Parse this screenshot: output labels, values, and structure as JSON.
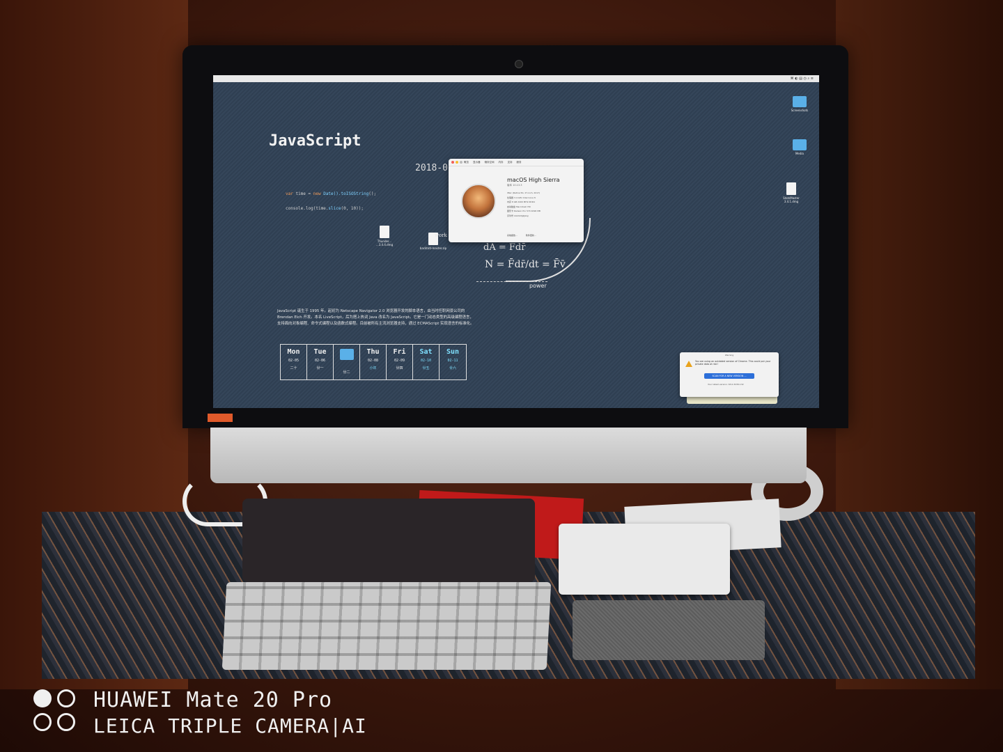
{
  "screen": {
    "title": "JavaScript",
    "date_fragment": "2018-0",
    "code_lines": [
      {
        "kw": "var",
        "rest": " time = ",
        "kw2": "new",
        "fn": " Date().toISOString",
        "tail": "();"
      },
      {
        "plain": "console.log(time.",
        "fn": "slice",
        "tail": "(0, 10));"
      }
    ],
    "desktop_icons": [
      {
        "label": "Thunder...\n...3.4.4.dmg",
        "kind": "doc"
      },
      {
        "label": "backtotl-master.zip",
        "kind": "doc"
      },
      {
        "label": "Screenshots",
        "kind": "folder"
      },
      {
        "label": "Media",
        "kind": "folder"
      },
      {
        "label": "StatsMaster 3.4.1.dmg",
        "kind": "doc"
      }
    ],
    "formulas": {
      "dA": "dA = F̄dr̄",
      "N": "N = F̄dr̄/dt = F̄v̄",
      "caption": "power",
      "side_word": "work"
    },
    "paragraph": "JavaScript 诞生于 1995 年。起初为 Netscape Navigator 2.0 浏览器开发的脚本语言，由当时任职网景公司的 Brendan Eich 开发。本名 LiveScript，后为搭上热词 Java 改名为 JavaScript。它是一门动态类型的高级编程语言，支持面向对象编程、命令式编程以及函数式编程。目前被所有主流浏览器支持，通过 ECMAScript 实现语言的标准化。",
    "calendar": [
      {
        "day": "Mon",
        "date": "02-05",
        "lunar": "二十",
        "weekend": false
      },
      {
        "day": "Tue",
        "date": "02-06",
        "lunar": "廿一",
        "weekend": false
      },
      {
        "day": "",
        "date": "",
        "lunar": "廿二",
        "weekend": false,
        "folder": true
      },
      {
        "day": "Thu",
        "date": "02-08",
        "lunar": "小年",
        "weekend": false,
        "lunar_highlight": true
      },
      {
        "day": "Fri",
        "date": "02-09",
        "lunar": "廿四",
        "weekend": false
      },
      {
        "day": "Sat",
        "date": "02-10",
        "lunar": "廿五",
        "weekend": true
      },
      {
        "day": "Sun",
        "date": "02-11",
        "lunar": "廿六",
        "weekend": true
      }
    ],
    "about_window": {
      "tabs": [
        "概览",
        "显示器",
        "储存空间",
        "内存",
        "支持",
        "服务"
      ],
      "os_name": "macOS High Sierra",
      "version": "版本 10.13.3",
      "details": [
        "iMac (Retina 5K, 27-inch, 2017)",
        "处理器 3.4 GHz Intel Core i5",
        "内存 8 GB 2400 MHz DDR4",
        "启动磁盘 Macintosh HD",
        "图形卡 Radeon Pro 570 4096 MB",
        "序列号 C02V2SJ0J1GJ"
      ],
      "buttons": [
        "系统报告...",
        "软件更新..."
      ]
    },
    "notification": {
      "title": "Warning",
      "text": "You are using an outdated version of Chrome. This could put your private data at risk!",
      "button": "SCAN FOR A NEW VERSION ...",
      "footer": "Your latest version: 63.0.3239.132"
    }
  },
  "watermark": {
    "line1": "HUAWEI Mate 20 Pro",
    "line2": "LEICA TRIPLE CAMERA|AI"
  },
  "colors": {
    "screen_bg": "#35465a",
    "accent_cyan": "#7fe0ff",
    "room_wood": "#5a2a18"
  }
}
